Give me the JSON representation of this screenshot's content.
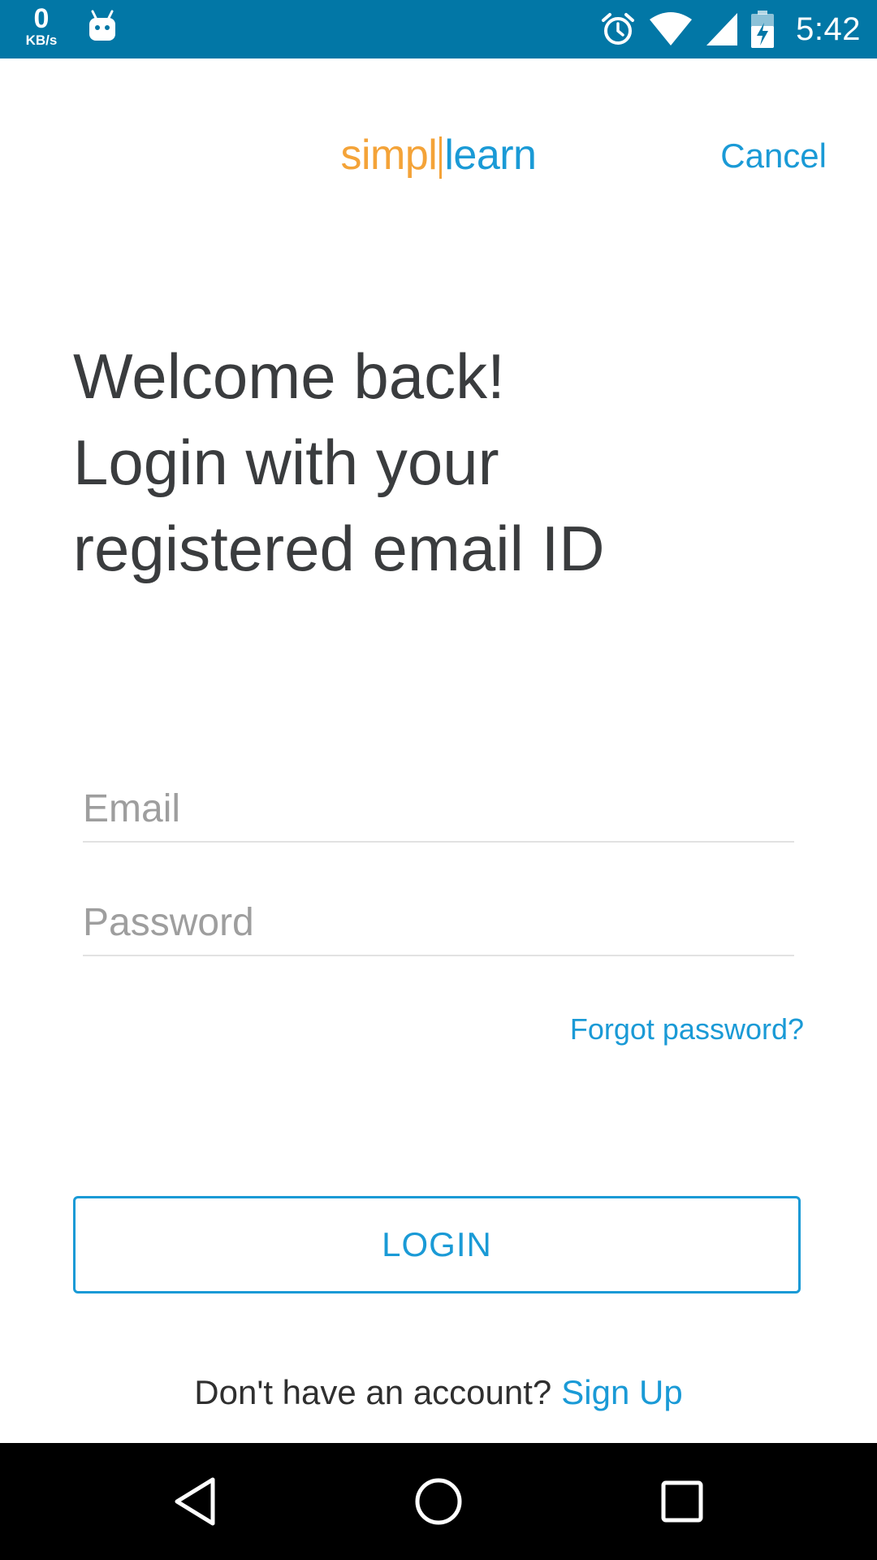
{
  "status_bar": {
    "net_speed_value": "0",
    "net_speed_unit": "KB/s",
    "time": "5:42",
    "icons": [
      "android-notification-icon",
      "alarm-icon",
      "wifi-icon",
      "cell-signal-icon",
      "battery-charging-icon"
    ],
    "background_color": "#0277a6"
  },
  "header": {
    "logo_text_left": "simpl",
    "logo_text_right": "learn",
    "cancel_label": "Cancel"
  },
  "heading": {
    "line1": "Welcome back!",
    "line2": "Login with your",
    "line3": "registered email ID"
  },
  "form": {
    "email_placeholder": "Email",
    "email_value": "",
    "password_placeholder": "Password",
    "password_value": "",
    "forgot_label": "Forgot password?",
    "login_label": "LOGIN"
  },
  "footer": {
    "no_account_text": "Don't have an account?",
    "signup_label": "Sign Up"
  },
  "nav_bar": {
    "icons": [
      "back-icon",
      "home-icon",
      "recent-apps-icon"
    ]
  },
  "colors": {
    "accent": "#1a9ad6",
    "logo_orange": "#f4a338",
    "heading_text": "#3a3c3e"
  }
}
